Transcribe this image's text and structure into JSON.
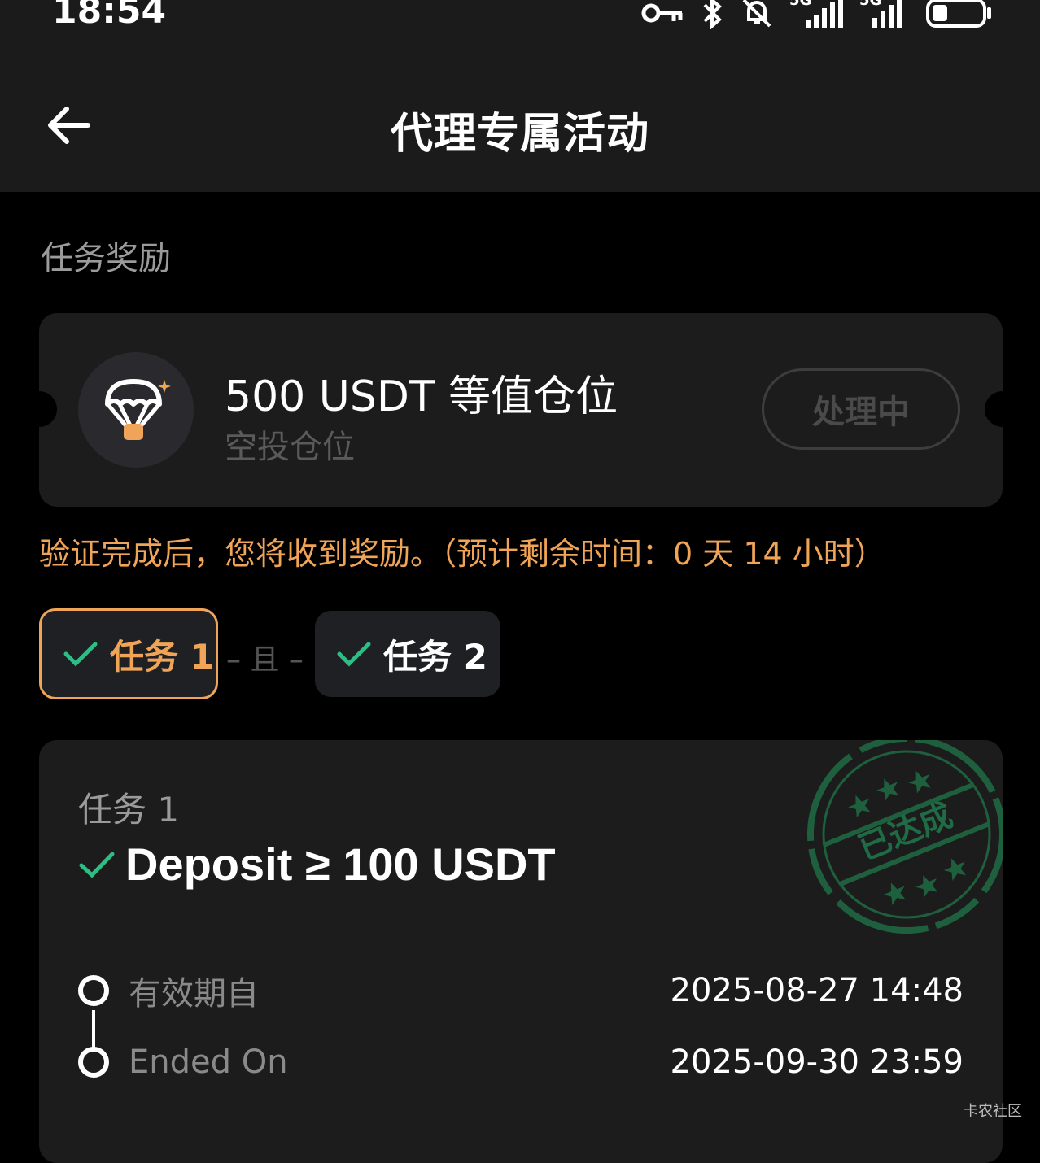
{
  "status_bar": {
    "time": "18:54",
    "signal_1": "5G",
    "signal_2": "5G"
  },
  "header": {
    "title": "代理专属活动"
  },
  "section": {
    "title": "任务奖励"
  },
  "reward": {
    "title": "500 USDT 等值仓位",
    "subtitle": "空投仓位",
    "status": "处理中"
  },
  "notice": "验证完成后，您将收到奖励。（预计剩余时间：0 天 14 小时）",
  "tasks": {
    "tab1": "任务 1",
    "connector": "– 且 –",
    "tab2": "任务 2"
  },
  "task_detail": {
    "label": "任务 1",
    "requirement": "Deposit ≥ 100 USDT",
    "stamp_text": "已达成",
    "valid_from_label": "有效期自",
    "valid_from_value": "2025-08-27 14:48",
    "ended_on_label": "Ended On",
    "ended_on_value": "2025-09-30 23:59"
  },
  "watermark": "卡农社区",
  "colors": {
    "accent": "#f0a457",
    "check": "#2ebd85",
    "stamp": "#1f6b45"
  }
}
